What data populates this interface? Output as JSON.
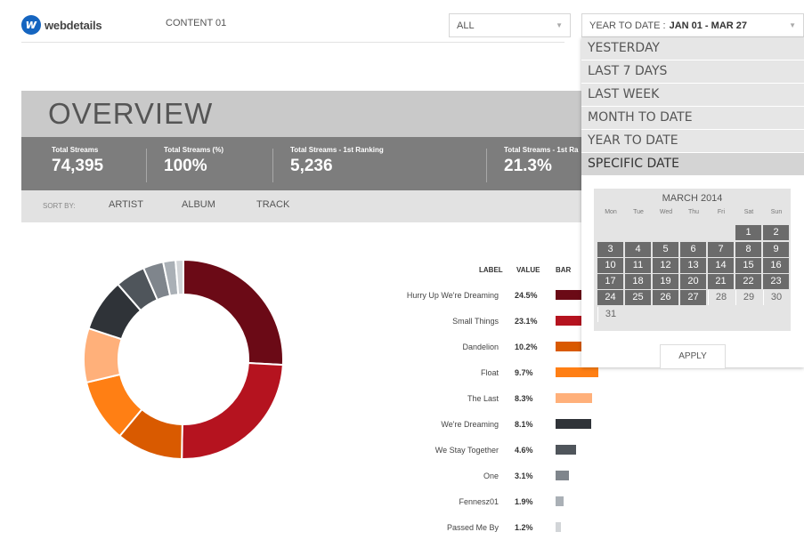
{
  "header": {
    "logo_mark": "w",
    "logo_text": "webdetails",
    "content_label": "CONTENT 01",
    "filter_value": "ALL",
    "date_prefix": "YEAR TO DATE :",
    "date_range": "JAN 01 - MAR 27"
  },
  "overview": {
    "title": "OVERVIEW",
    "stats": [
      {
        "label": "Total Streams",
        "value": "74,395"
      },
      {
        "label": "Total Streams (%)",
        "value": "100%"
      },
      {
        "label": "Total Streams - 1st Ranking",
        "value": "5,236"
      },
      {
        "label": "Total Streams - 1st Ra",
        "value": "21.3%"
      }
    ],
    "sort_by": "SORT BY:",
    "sort_options": [
      "ARTIST",
      "ALBUM",
      "TRACK"
    ]
  },
  "table": {
    "headers": {
      "label": "LABEL",
      "value": "VALUE",
      "bar": "BAR"
    }
  },
  "chart_data": {
    "type": "pie",
    "categories": [
      "Hurry Up We're Dreaming",
      "Small Things",
      "Dandelion",
      "Float",
      "The Last",
      "We're Dreaming",
      "We Stay Together",
      "One",
      "Fennesz01",
      "Passed Me By"
    ],
    "values": [
      24.5,
      23.1,
      10.2,
      9.7,
      8.3,
      8.1,
      4.6,
      3.1,
      1.9,
      1.2
    ],
    "value_labels": [
      "24.5%",
      "23.1%",
      "10.2%",
      "9.7%",
      "8.3%",
      "8.1%",
      "4.6%",
      "3.1%",
      "1.9%",
      "1.2%"
    ],
    "colors": [
      "#6b0a16",
      "#b5131f",
      "#d95a00",
      "#ff7f14",
      "#ffb07a",
      "#2f3338",
      "#4f555b",
      "#7f858c",
      "#aab0b6",
      "#d2d5d8"
    ]
  },
  "dropdown": {
    "items": [
      "YESTERDAY",
      "LAST 7 DAYS",
      "LAST WEEK",
      "MONTH TO DATE",
      "YEAR TO DATE",
      "SPECIFIC DATE"
    ],
    "selected": "SPECIFIC DATE",
    "calendar": {
      "title": "MARCH 2014",
      "weekdays": [
        "Mon",
        "Tue",
        "Wed",
        "Thu",
        "Fri",
        "Sat",
        "Sun"
      ],
      "days": [
        "1",
        "2",
        "3",
        "4",
        "5",
        "6",
        "7",
        "8",
        "9",
        "10",
        "11",
        "12",
        "13",
        "14",
        "15",
        "16",
        "17",
        "18",
        "19",
        "20",
        "21",
        "22",
        "23",
        "24",
        "25",
        "26",
        "27",
        "28",
        "29",
        "30",
        "31"
      ]
    },
    "apply_label": "APPLY"
  }
}
